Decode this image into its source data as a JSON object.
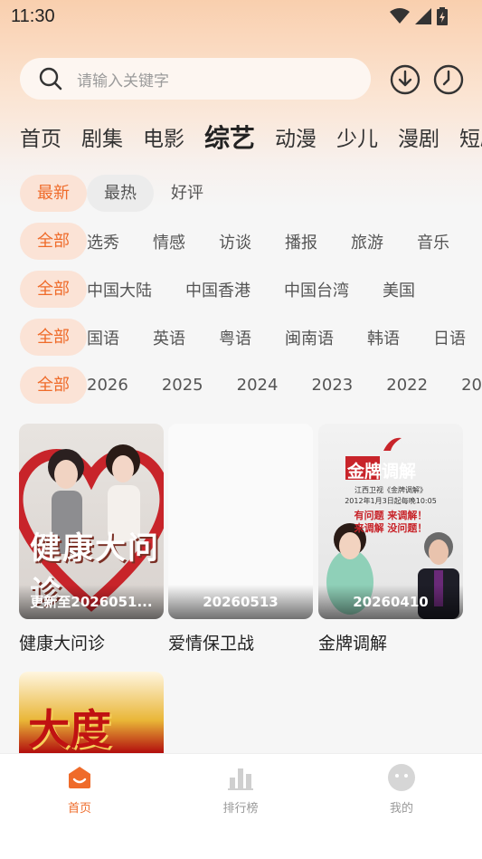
{
  "status_bar": {
    "time": "11:30"
  },
  "search": {
    "placeholder": "请输入关键字"
  },
  "channels": [
    "首页",
    "剧集",
    "电影",
    "综艺",
    "动漫",
    "少儿",
    "漫剧",
    "短剧"
  ],
  "active_channel": "综艺",
  "filters": {
    "sort": {
      "selected": "最新",
      "options": [
        "最新",
        "最热",
        "好评"
      ]
    },
    "genre": {
      "selected": "全部",
      "options": [
        "选秀",
        "情感",
        "访谈",
        "播报",
        "旅游",
        "音乐"
      ]
    },
    "region": {
      "selected": "全部",
      "options": [
        "中国大陆",
        "中国香港",
        "中国台湾",
        "美国"
      ]
    },
    "language": {
      "selected": "全部",
      "options": [
        "国语",
        "英语",
        "粤语",
        "闽南语",
        "韩语",
        "日语"
      ]
    },
    "year": {
      "selected": "全部",
      "options": [
        "2026",
        "2025",
        "2024",
        "2023",
        "2022",
        "20"
      ]
    }
  },
  "cards": [
    {
      "title": "健康大问诊",
      "badge": "更新至2026051...",
      "poster_text": "健康大问诊"
    },
    {
      "title": "爱情保卫战",
      "badge": "20260513",
      "poster_text": ""
    },
    {
      "title": "金牌调解",
      "badge": "20260410",
      "poster_text": "金牌调解",
      "poster_sub": "江西卫视《金牌调解》",
      "poster_date": "2012年1月3日起每晚10:05",
      "poster_slogan1": "有问题 来调解！",
      "poster_slogan2": "来调解 没问题！"
    },
    {
      "title": "",
      "badge": "",
      "poster_text": "大度"
    }
  ],
  "bottom_nav": [
    {
      "label": "首页",
      "icon": "home-icon",
      "active": true
    },
    {
      "label": "排行榜",
      "icon": "chart-icon",
      "active": false
    },
    {
      "label": "我的",
      "icon": "profile-icon",
      "active": false
    }
  ],
  "colors": {
    "accent": "#ef6b2a",
    "chip_active_bg": "#fbe3d6"
  }
}
